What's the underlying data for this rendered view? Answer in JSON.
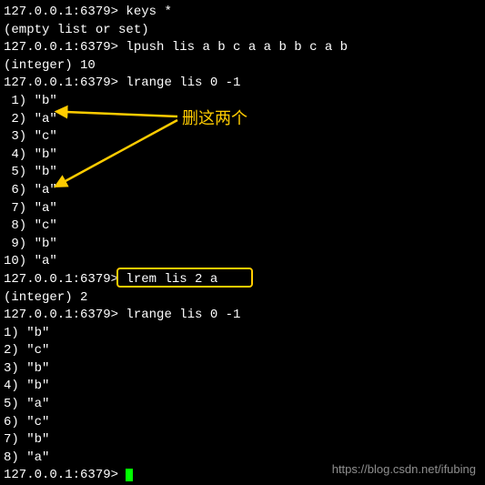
{
  "prompt": "127.0.0.1:6379>",
  "cmd_keys": " keys *",
  "resp_keys": "(empty list or set)",
  "cmd_lpush": " lpush lis a b c a a b b c a b",
  "resp_lpush": "(integer) 10",
  "cmd_lrange1": " lrange lis 0 -1",
  "list1": [
    " 1) \"b\"",
    " 2) \"a\"",
    " 3) \"c\"",
    " 4) \"b\"",
    " 5) \"b\"",
    " 6) \"a\"",
    " 7) \"a\"",
    " 8) \"c\"",
    " 9) \"b\"",
    "10) \"a\""
  ],
  "cmd_lrem": " lrem lis 2 a",
  "resp_lrem": "(integer) 2",
  "cmd_lrange2": " lrange lis 0 -1",
  "list2": [
    "1) \"b\"",
    "2) \"c\"",
    "3) \"b\"",
    "4) \"b\"",
    "5) \"a\"",
    "6) \"c\"",
    "7) \"b\"",
    "8) \"a\""
  ],
  "annotation_label": "删这两个",
  "watermark": "https://blog.csdn.net/ifubing",
  "colors": {
    "annotation": "#ffcc00",
    "cursor": "#00ff00"
  }
}
